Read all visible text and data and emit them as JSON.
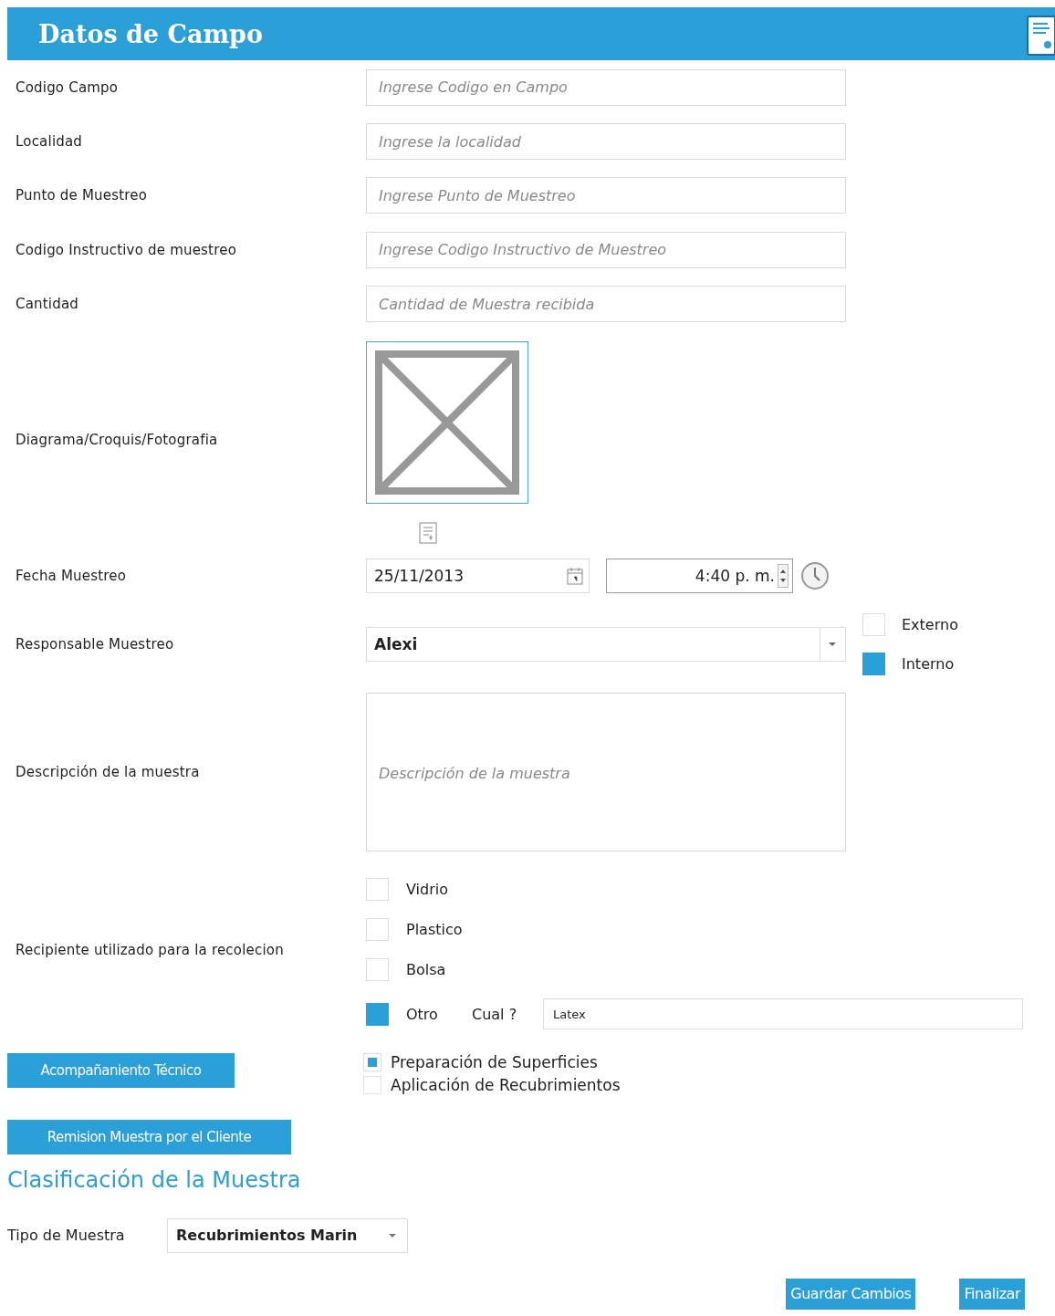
{
  "header": {
    "title": "Datos de Campo"
  },
  "rows": [
    {
      "kind": "text",
      "label": "Codigo Campo",
      "placeholder": "Ingrese Codigo en Campo"
    },
    {
      "kind": "text",
      "label": "Localidad",
      "placeholder": "Ingrese la localidad"
    },
    {
      "kind": "text",
      "label": "Punto de Muestreo",
      "placeholder": "Ingrese Punto de Muestreo"
    },
    {
      "kind": "text",
      "label": "Codigo Instructivo de muestreo",
      "placeholder": "Ingrese Codigo Instructivo de Muestreo"
    },
    {
      "kind": "text",
      "label": "Cantidad",
      "placeholder": "Cantidad de Muestra recibida"
    },
    {
      "kind": "image",
      "label": "Diagrama/Croquis/Fotografia"
    },
    {
      "kind": "datetime",
      "label": "Fecha Muestreo",
      "date": "25/11/2013",
      "time": "4:40 p. m."
    },
    {
      "kind": "combo",
      "label": "Responsable Muestreo",
      "value": "Alexi",
      "options": [
        {
          "label": "Externo",
          "checked": false
        },
        {
          "label": "Interno",
          "checked": true
        }
      ]
    },
    {
      "kind": "textarea",
      "label": "Descripción de la muestra",
      "placeholder": "Descripción de la muestra"
    },
    {
      "kind": "checklist",
      "label": "Recipiente utilizado para la recolecion",
      "items": [
        {
          "label": "Vidrio",
          "checked": false
        },
        {
          "label": "Plastico",
          "checked": false
        },
        {
          "label": "Bolsa",
          "checked": false
        },
        {
          "label": "Otro",
          "checked": true
        }
      ],
      "other": {
        "label": "Cual ?",
        "value": "Latex"
      }
    }
  ],
  "acompanamiento": {
    "button": "Acompañaniento Técnico",
    "options": [
      {
        "label": "Preparación de Superficies",
        "checked": true
      },
      {
        "label": "Aplicación de Recubrimientos",
        "checked": false
      }
    ]
  },
  "remision_button": "Remision Muestra por el Cliente",
  "section_title": "Clasificación de la Muestra",
  "tipo": {
    "label": "Tipo de Muestra",
    "value": "Recubrimientos Marin"
  },
  "actions": [
    "Guardar Cambios",
    "Finalizar"
  ]
}
